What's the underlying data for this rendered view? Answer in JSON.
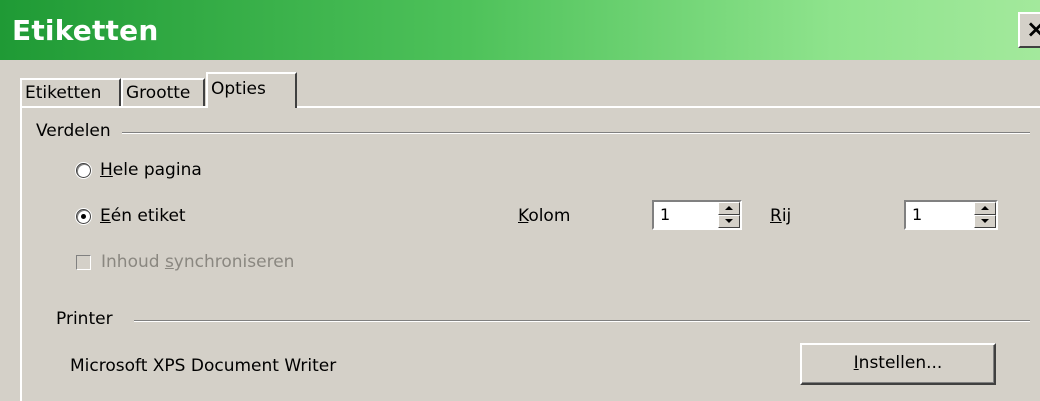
{
  "window": {
    "title": "Etiketten",
    "close_glyph": "×"
  },
  "tabs": [
    {
      "label": "Etiketten",
      "active": false
    },
    {
      "label": "Grootte",
      "active": false
    },
    {
      "label": "Opties",
      "active": true
    }
  ],
  "distribute": {
    "section_label": "Verdelen",
    "option_whole_page": {
      "mnemonic": "H",
      "rest": "ele pagina",
      "checked": false
    },
    "option_single_label": {
      "mnemonic": "E",
      "rest": "én etiket",
      "checked": true
    },
    "sync_contents": {
      "prefix": "Inhoud ",
      "mnemonic": "s",
      "rest": "ynchroniseren",
      "checked": false,
      "enabled": false
    },
    "column": {
      "mnemonic": "K",
      "rest": "olom",
      "value": "1"
    },
    "row": {
      "mnemonic": "R",
      "rest": "ij",
      "value": "1"
    }
  },
  "printer": {
    "section_label": "Printer",
    "name": "Microsoft XPS Document Writer",
    "setup_button": {
      "mnemonic": "I",
      "rest": "nstellen..."
    }
  }
}
